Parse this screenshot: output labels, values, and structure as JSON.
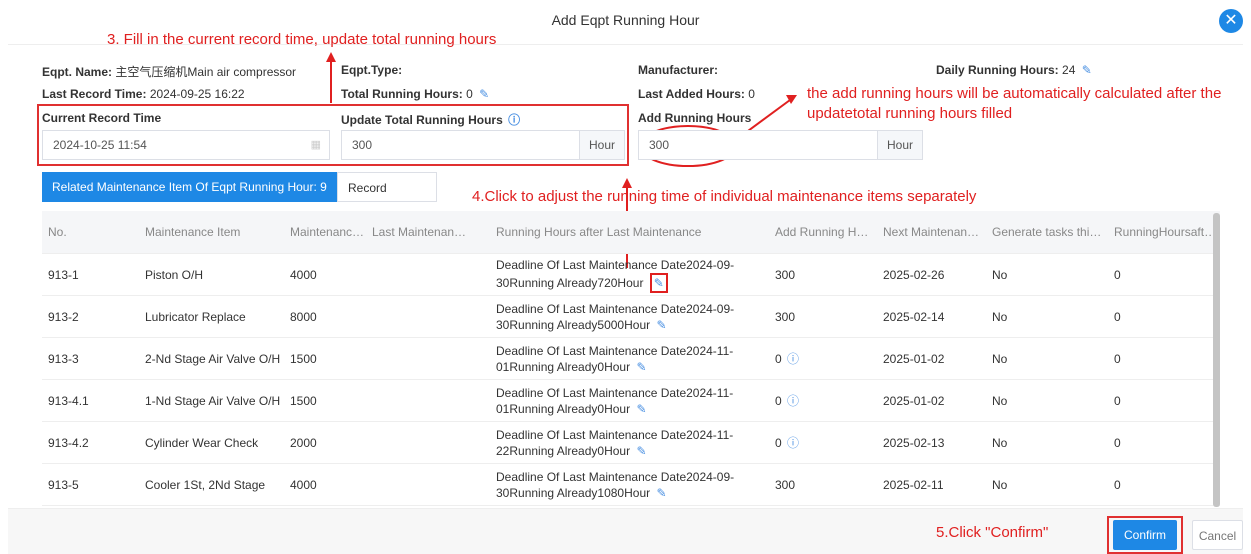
{
  "dialog": {
    "title": "Add Eqpt Running Hour",
    "close_icon": "close-icon"
  },
  "annotations": {
    "step3": "3. Fill in the current record time, update total running hours",
    "auto_calc_line1": "the add running hours will be automatically calculated after the",
    "auto_calc_line2": "updatetotal running hours filled",
    "step4": "4.Click to adjust the running time of individual maintenance items separately",
    "step5": "5.Click \"Confirm\""
  },
  "info": {
    "eqpt_name_label": "Eqpt. Name:",
    "eqpt_name_value": "主空气压缩机Main air compressor",
    "eqpt_type_label": "Eqpt.Type:",
    "manufacturer_label": "Manufacturer:",
    "daily_label": "Daily Running Hours:",
    "daily_value": "24",
    "last_record_label": "Last Record Time:",
    "last_record_value": "2024-09-25 16:22",
    "total_label": "Total Running Hours:",
    "total_value": "0",
    "last_added_label": "Last Added Hours:",
    "last_added_value": "0"
  },
  "form": {
    "current_record_label": "Current Record Time",
    "current_record_value": "2024-10-25 11:54",
    "update_total_label": "Update Total Running Hours",
    "update_total_value": "300",
    "add_running_label": "Add Running Hours",
    "add_running_value": "300",
    "unit": "Hour"
  },
  "tabs": {
    "related": "Related Maintenance Item Of Eqpt Running Hour: 9",
    "history": "Record History"
  },
  "table": {
    "headers": [
      "No.",
      "Maintenance Item",
      "Maintenance …",
      "Last Maintenan…",
      "Running Hours after Last Maintenance",
      "Add Running H…",
      "Next Maintenan…",
      "Generate tasks thi…",
      "RunningHoursafte…"
    ],
    "rows": [
      {
        "no": "913-1",
        "item": "Piston O/H",
        "interval": "4000",
        "last": "",
        "running": "Deadline Of Last Maintenance Date2024-09-30Running Already720Hour",
        "add": "300",
        "next": "2025-02-26",
        "generate": "No",
        "after": "0"
      },
      {
        "no": "913-2",
        "item": "Lubricator Replace",
        "interval": "8000",
        "last": "",
        "running": "Deadline Of Last Maintenance Date2024-09-30Running Already5000Hour",
        "add": "300",
        "next": "2025-02-14",
        "generate": "No",
        "after": "0"
      },
      {
        "no": "913-3",
        "item": "2-Nd Stage Air Valve O/H",
        "interval": "1500",
        "last": "",
        "running": "Deadline Of Last Maintenance Date2024-11-01Running Already0Hour",
        "add": "0",
        "next": "2025-01-02",
        "generate": "No",
        "after": "0"
      },
      {
        "no": "913-4.1",
        "item": "1-Nd Stage Air Valve O/H",
        "interval": "1500",
        "last": "",
        "running": "Deadline Of Last Maintenance Date2024-11-01Running Already0Hour",
        "add": "0",
        "next": "2025-01-02",
        "generate": "No",
        "after": "0"
      },
      {
        "no": "913-4.2",
        "item": "Cylinder Wear Check",
        "interval": "2000",
        "last": "",
        "running": "Deadline Of Last Maintenance Date2024-11-22Running Already0Hour",
        "add": "0",
        "next": "2025-02-13",
        "generate": "No",
        "after": "0"
      },
      {
        "no": "913-5",
        "item": "Cooler 1St, 2Nd Stage",
        "interval": "4000",
        "last": "",
        "running": "Deadline Of Last Maintenance Date2024-09-30Running Already1080Hour",
        "add": "300",
        "next": "2025-02-11",
        "generate": "No",
        "after": "0"
      }
    ]
  },
  "footer": {
    "confirm": "Confirm",
    "cancel": "Cancel"
  },
  "colors": {
    "accent": "#1e88e5",
    "annotation": "#e02020"
  }
}
